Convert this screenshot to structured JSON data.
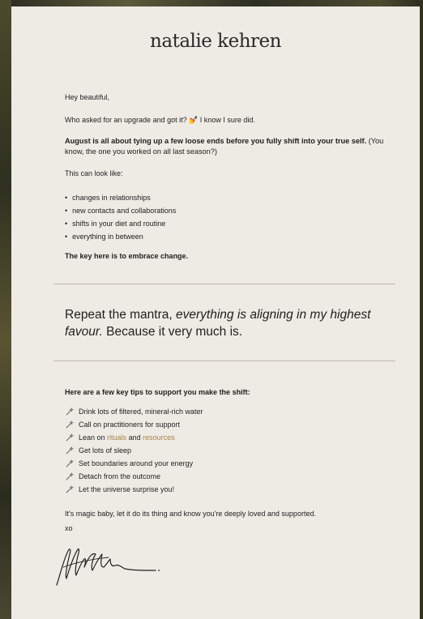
{
  "brand": "natalie kehren",
  "greeting": "Hey beautiful,",
  "intro": "Who asked for an upgrade and got it? 💅 I know I sure did.",
  "august_bold": "August is all about tying up a few loose ends before you fully shift into your true self.",
  "august_rest": " (You know, the one you worked on all last season?)",
  "look_like": "This can look like:",
  "list_items": [
    "changes in relationships",
    "new contacts and collaborations",
    "shifts in your diet and routine",
    "everything in between"
  ],
  "key": "The key here is to embrace change.",
  "mantra": {
    "prefix": "Repeat the mantra, ",
    "italic": "everything is aligning in my highest favour.",
    "suffix": " Because it very much is."
  },
  "tips_title": "Here are a few key tips to support you make the shift:",
  "tips": {
    "t1": "Drink lots of filtered, mineral-rich water",
    "t2": "Call on practitioners for support",
    "t3_prefix": "Lean on ",
    "t3_link1": "rituals",
    "t3_mid": " and ",
    "t3_link2": "resources",
    "t4": "Get lots of sleep",
    "t5": "Set boundaries around your energy",
    "t6": "Detach from the outcome",
    "t7": "Let the universe surprise you!"
  },
  "tip_icon": "magic-wand-icon",
  "closing": "It's magic baby, let it do its thing and know you're deeply loved and supported.",
  "signoff": "xo",
  "colors": {
    "card": "#eeeae4",
    "text": "#1f1f1f",
    "link": "#a78548",
    "divider": "#bdb8b0"
  }
}
